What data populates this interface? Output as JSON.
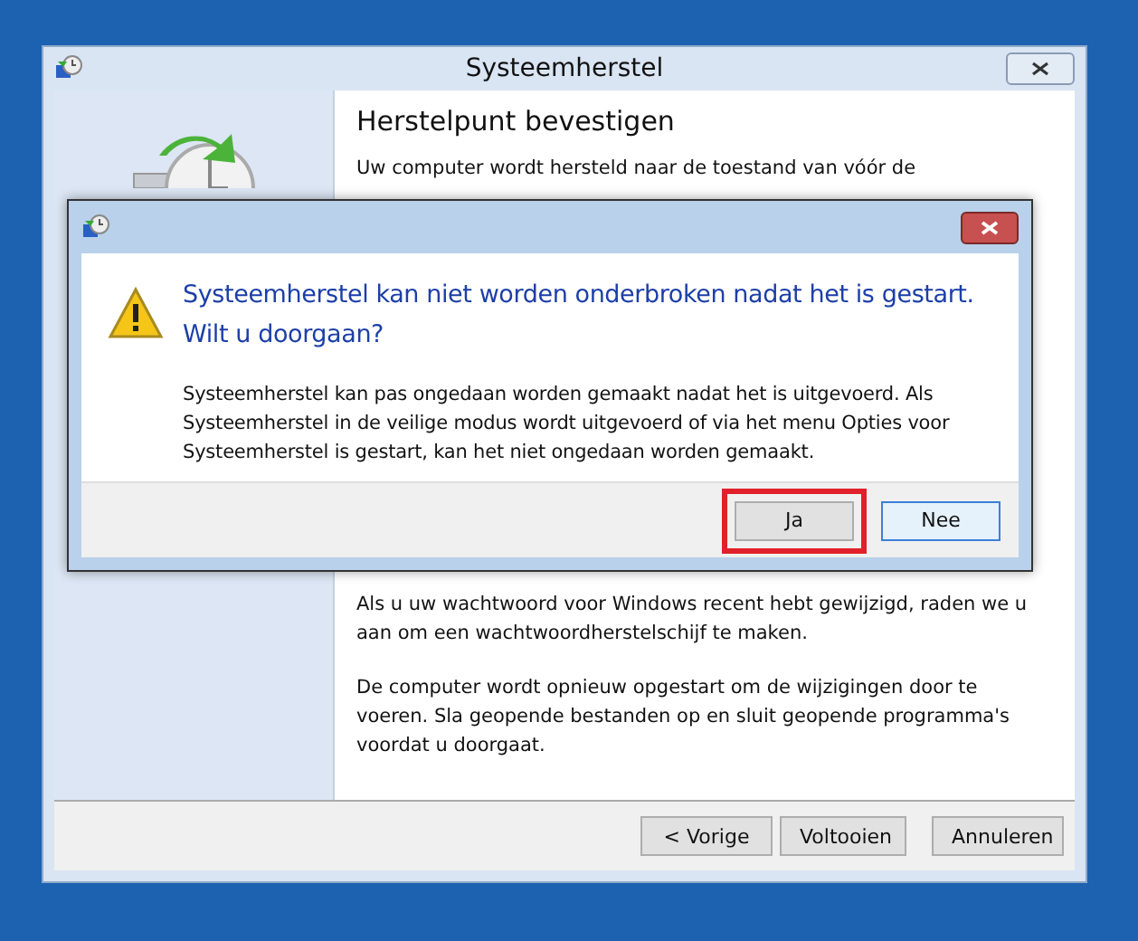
{
  "window": {
    "title": "Systeemherstel"
  },
  "page": {
    "heading": "Herstelpunt bevestigen",
    "paragraphs": [
      "Uw computer wordt hersteld naar de toestand van vóór de",
      "Als u uw wachtwoord voor Windows recent hebt gewijzigd, raden we u aan om een wachtwoordherstelschijf te maken.",
      "De computer wordt opnieuw opgestart om de wijzigingen door te voeren. Sla geopende bestanden op en sluit geopende programma's voordat u doorgaat."
    ]
  },
  "buttons": [
    "< Vorige",
    "Voltooien",
    "Annuleren"
  ],
  "dialog": {
    "instruction": "Systeemherstel kan niet worden onderbroken nadat het is gestart. Wilt u doorgaan?",
    "message": "Systeemherstel kan pas ongedaan worden gemaakt nadat het is uitgevoerd. Als Systeemherstel in de veilige modus wordt uitgevoerd of via het menu Opties voor Systeemherstel is gestart, kan het niet ongedaan worden gemaakt.",
    "buttons": [
      {
        "label": "Ja",
        "highlighted": true,
        "default": false
      },
      {
        "label": "Nee",
        "highlighted": false,
        "default": true
      }
    ]
  }
}
